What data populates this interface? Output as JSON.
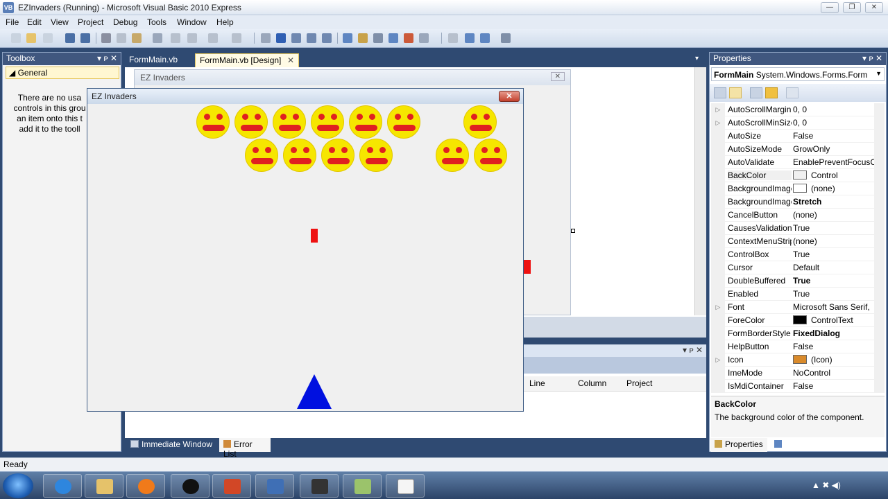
{
  "window": {
    "title": "EZInvaders (Running) - Microsoft Visual Basic 2010 Express",
    "app_icon": "VB",
    "minimize": "—",
    "maximize": "❐",
    "close": "✕"
  },
  "menu": [
    "File",
    "Edit",
    "View",
    "Project",
    "Debug",
    "Tools",
    "Window",
    "Help"
  ],
  "toolbox": {
    "title": "Toolbox",
    "pin": "▾ ᴘ ✕",
    "group": "◢ General",
    "message": "There are no usa\ncontrols in this grou\nan item onto this t\nadd it to the tooll"
  },
  "editor": {
    "tabs": [
      "FormMain.vb",
      "FormMain.vb [Design]"
    ],
    "tab_close": "✕",
    "designer_caption": "EZ Invaders",
    "designer_close": "✕"
  },
  "error_list": {
    "columns": [
      "Line",
      "Column",
      "Project"
    ],
    "controls": "▾ ᴘ ✕"
  },
  "bottom_tabs": [
    "Immediate Window",
    "Error List"
  ],
  "properties": {
    "title": "Properties",
    "controls": "▾ ᴘ ✕",
    "selector_name": "FormMain",
    "selector_type": "System.Windows.Forms.Form",
    "rows": [
      {
        "name": "AutoScrollMargin",
        "value": "0, 0",
        "expand": "▷"
      },
      {
        "name": "AutoScrollMinSize",
        "value": "0, 0",
        "expand": "▷"
      },
      {
        "name": "AutoSize",
        "value": "False",
        "expand": ""
      },
      {
        "name": "AutoSizeMode",
        "value": "GrowOnly",
        "expand": ""
      },
      {
        "name": "AutoValidate",
        "value": "EnablePreventFocusChange",
        "expand": ""
      },
      {
        "name": "BackColor",
        "value": "Control",
        "expand": "",
        "swatch": "#f0f0f0",
        "selected": true
      },
      {
        "name": "BackgroundImage",
        "value": "(none)",
        "expand": "",
        "swatch": "#ffffff"
      },
      {
        "name": "BackgroundImageLayout",
        "value": "Stretch",
        "expand": "",
        "bold": true
      },
      {
        "name": "CancelButton",
        "value": "(none)",
        "expand": ""
      },
      {
        "name": "CausesValidation",
        "value": "True",
        "expand": ""
      },
      {
        "name": "ContextMenuStrip",
        "value": "(none)",
        "expand": ""
      },
      {
        "name": "ControlBox",
        "value": "True",
        "expand": ""
      },
      {
        "name": "Cursor",
        "value": "Default",
        "expand": ""
      },
      {
        "name": "DoubleBuffered",
        "value": "True",
        "expand": "",
        "bold": true
      },
      {
        "name": "Enabled",
        "value": "True",
        "expand": ""
      },
      {
        "name": "Font",
        "value": "Microsoft Sans Serif,",
        "expand": "▷"
      },
      {
        "name": "ForeColor",
        "value": "ControlText",
        "expand": "",
        "swatch": "#000000"
      },
      {
        "name": "FormBorderStyle",
        "value": "FixedDialog",
        "expand": "",
        "bold": true
      },
      {
        "name": "HelpButton",
        "value": "False",
        "expand": ""
      },
      {
        "name": "Icon",
        "value": "(Icon)",
        "expand": "▷",
        "swatch": "#d98a2b"
      },
      {
        "name": "ImeMode",
        "value": "NoControl",
        "expand": ""
      },
      {
        "name": "IsMdiContainer",
        "value": "False",
        "expand": ""
      }
    ],
    "description_title": "BackColor",
    "description_text": "The background color of the component.",
    "tabs": [
      "Properties",
      "Solution Explorer"
    ]
  },
  "status": "Ready",
  "taskbar": {
    "items": [
      "explorer-folder",
      "internet-explorer",
      "media-player",
      "hp",
      "powerpoint",
      "visual-basic",
      "camera",
      "stack",
      "notepad"
    ],
    "tray": "▲ ✖ ◀)"
  },
  "game": {
    "title": "EZ Invaders",
    "close": "✕",
    "invaders_row1_present": [
      true,
      true,
      true,
      true,
      true,
      true,
      false,
      true
    ],
    "invaders_row2_present": [
      false,
      true,
      true,
      true,
      true,
      false,
      true,
      true
    ],
    "colors": {
      "invader": "#f6e600",
      "face": "#e02020",
      "ship": "#0010e0",
      "bullet": "#ee1111"
    }
  }
}
